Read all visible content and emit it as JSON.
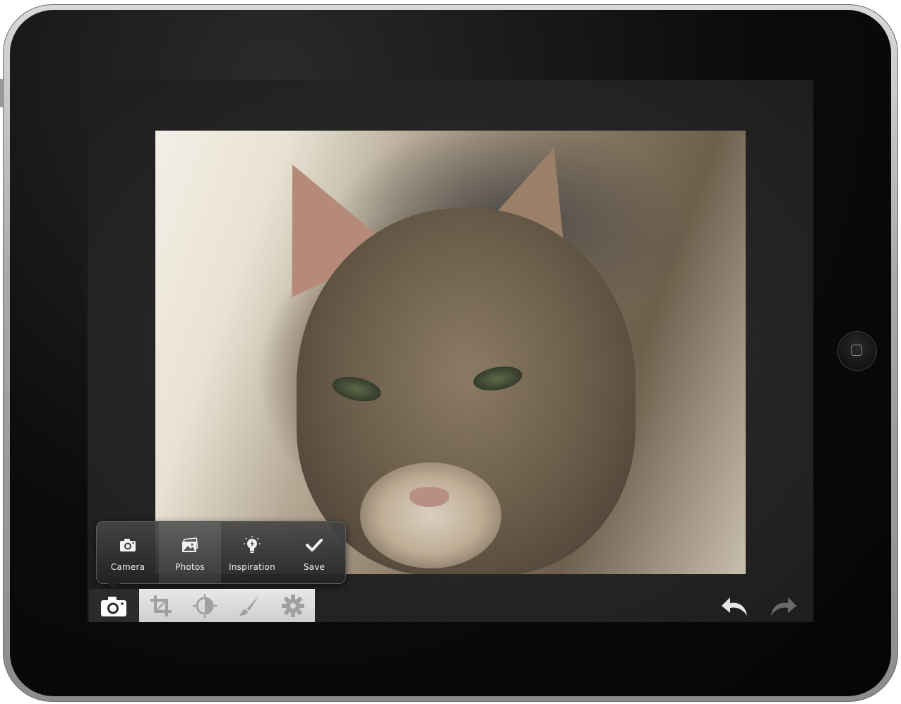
{
  "popover": {
    "items": [
      {
        "label": "Camera",
        "icon": "camera-icon"
      },
      {
        "label": "Photos",
        "icon": "photos-icon"
      },
      {
        "label": "Inspiration",
        "icon": "lightbulb-icon"
      },
      {
        "label": "Save",
        "icon": "checkmark-icon"
      }
    ]
  },
  "toolbar": {
    "active": "camera-icon",
    "tools": [
      "crop-icon",
      "brightness-icon",
      "brush-icon",
      "gear-icon"
    ],
    "actions": [
      "undo-icon",
      "redo-icon"
    ]
  },
  "colors": {
    "toolbar_tools_bg": "#d8d8d8",
    "screen_bg": "#282828",
    "icon_inactive": "#a0a0a0",
    "icon_active": "#ffffff"
  }
}
